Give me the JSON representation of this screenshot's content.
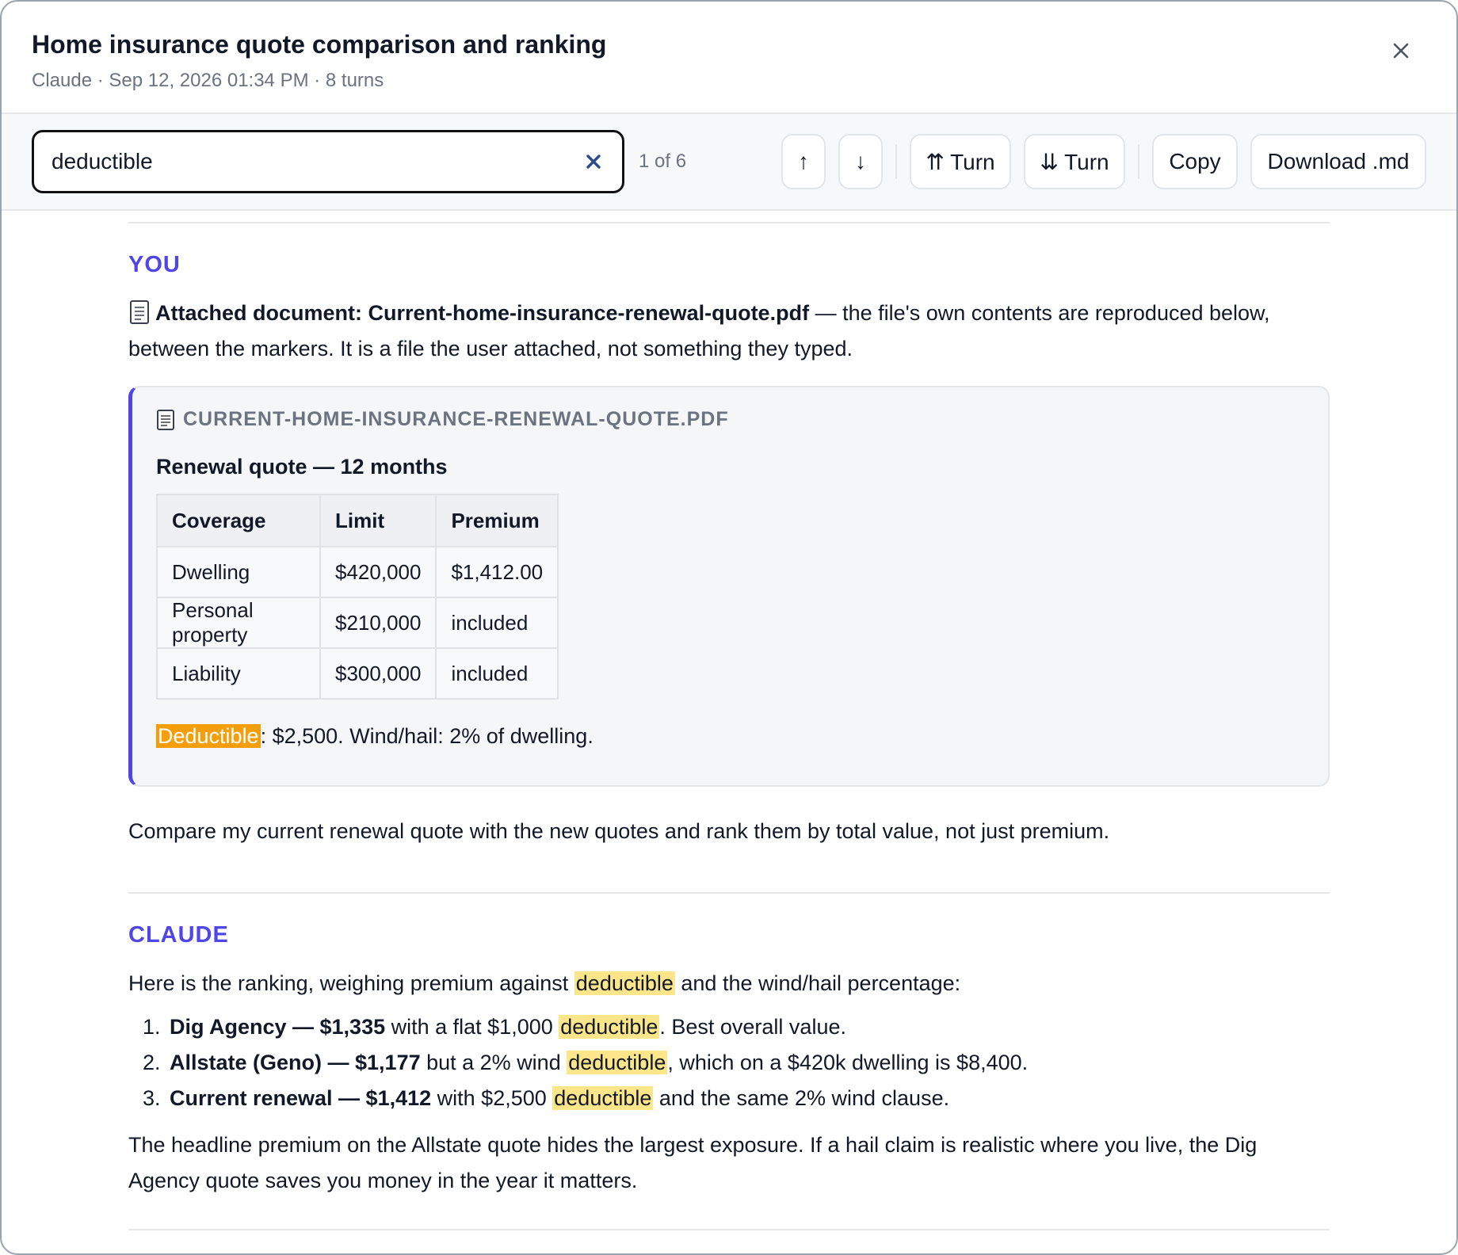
{
  "header": {
    "title": "Home insurance quote comparison and ranking",
    "meta": "Claude · Sep 12, 2026 01:34 PM · 8 turns",
    "close_icon": "close-icon"
  },
  "toolbar": {
    "search_value": "deductible",
    "match_count": "1 of 6",
    "prev_label": "↑",
    "next_label": "↓",
    "prev_turn_label": "⇈ Turn",
    "next_turn_label": "⇊ Turn",
    "copy_label": "Copy",
    "download_label": "Download .md"
  },
  "turns": [
    {
      "role": "YOU",
      "attachment_intro_bold": "Attached document: Current-home-insurance-renewal-quote.pdf",
      "attachment_intro_rest": " — the file's own contents are reproduced below, between the markers. It is a file the user attached, not something they typed.",
      "document": {
        "filename": "CURRENT-HOME-INSURANCE-RENEWAL-QUOTE.PDF",
        "heading": "Renewal quote — 12 months",
        "columns": [
          "Coverage",
          "Limit",
          "Premium"
        ],
        "rows": [
          [
            "Dwelling",
            "$420,000",
            "$1,412.00"
          ],
          [
            "Personal property",
            "$210,000",
            "included"
          ],
          [
            "Liability",
            "$300,000",
            "included"
          ]
        ],
        "footer_highlight": "Deductible",
        "footer_rest": ": $2,500. Wind/hail: 2% of dwelling."
      },
      "message": "Compare my current renewal quote with the new quotes and rank them by total value, not just premium."
    },
    {
      "role": "CLAUDE",
      "intro_before": "Here is the ranking, weighing premium against ",
      "intro_hl": "deductible",
      "intro_after": " and the wind/hail percentage:",
      "ranking": [
        {
          "bold": "Dig Agency — $1,335",
          "before": " with a flat $1,000 ",
          "hl": "deductible",
          "after": ". Best overall value."
        },
        {
          "bold": "Allstate (Geno) — $1,177",
          "before": " but a 2% wind ",
          "hl": "deductible",
          "after": ", which on a $420k dwelling is $8,400."
        },
        {
          "bold": "Current renewal — $1,412",
          "before": " with $2,500 ",
          "hl": "deductible",
          "after": " and the same 2% wind clause."
        }
      ],
      "closing": "The headline premium on the Allstate quote hides the largest exposure. If a hail claim is realistic where you live, the Dig Agency quote saves you money in the year it matters."
    }
  ],
  "colors": {
    "accent": "#4f46e5",
    "current_match": "#f59e0b",
    "match": "#fde68a"
  }
}
